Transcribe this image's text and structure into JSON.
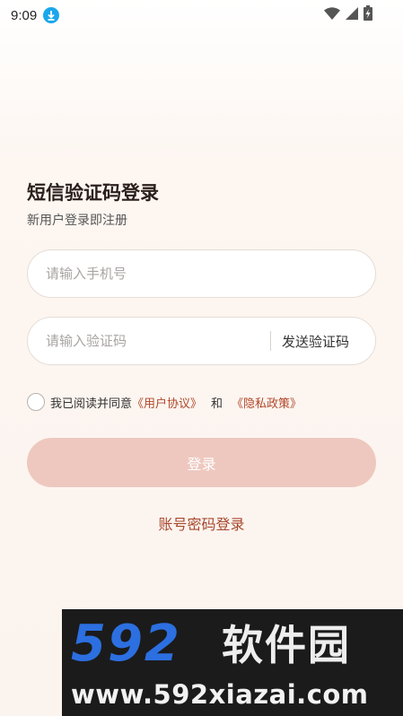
{
  "status_bar": {
    "time": "9:09",
    "download_icon": "download-arrow-icon",
    "wifi_icon": "wifi-icon",
    "signal_icon": "cell-signal-icon",
    "battery_icon": "battery-charging-icon"
  },
  "login": {
    "title": "短信验证码登录",
    "subtitle": "新用户登录即注册",
    "phone_placeholder": "请输入手机号",
    "code_placeholder": "请输入验证码",
    "send_code_label": "发送验证码",
    "agree_prefix": "我已阅读并同意",
    "user_agreement": "《用户协议》",
    "and_text": "和",
    "privacy_policy": "《隐私政策》",
    "login_button": "登录",
    "password_login": "账号密码登录"
  },
  "watermark": {
    "logo_digits": "592",
    "logo_text": "软件园",
    "url": "www.592xiazai.com"
  },
  "colors": {
    "accent": "#b0482a",
    "login_button_disabled": "#eec8bf",
    "download_badge": "#1aa7ec"
  }
}
